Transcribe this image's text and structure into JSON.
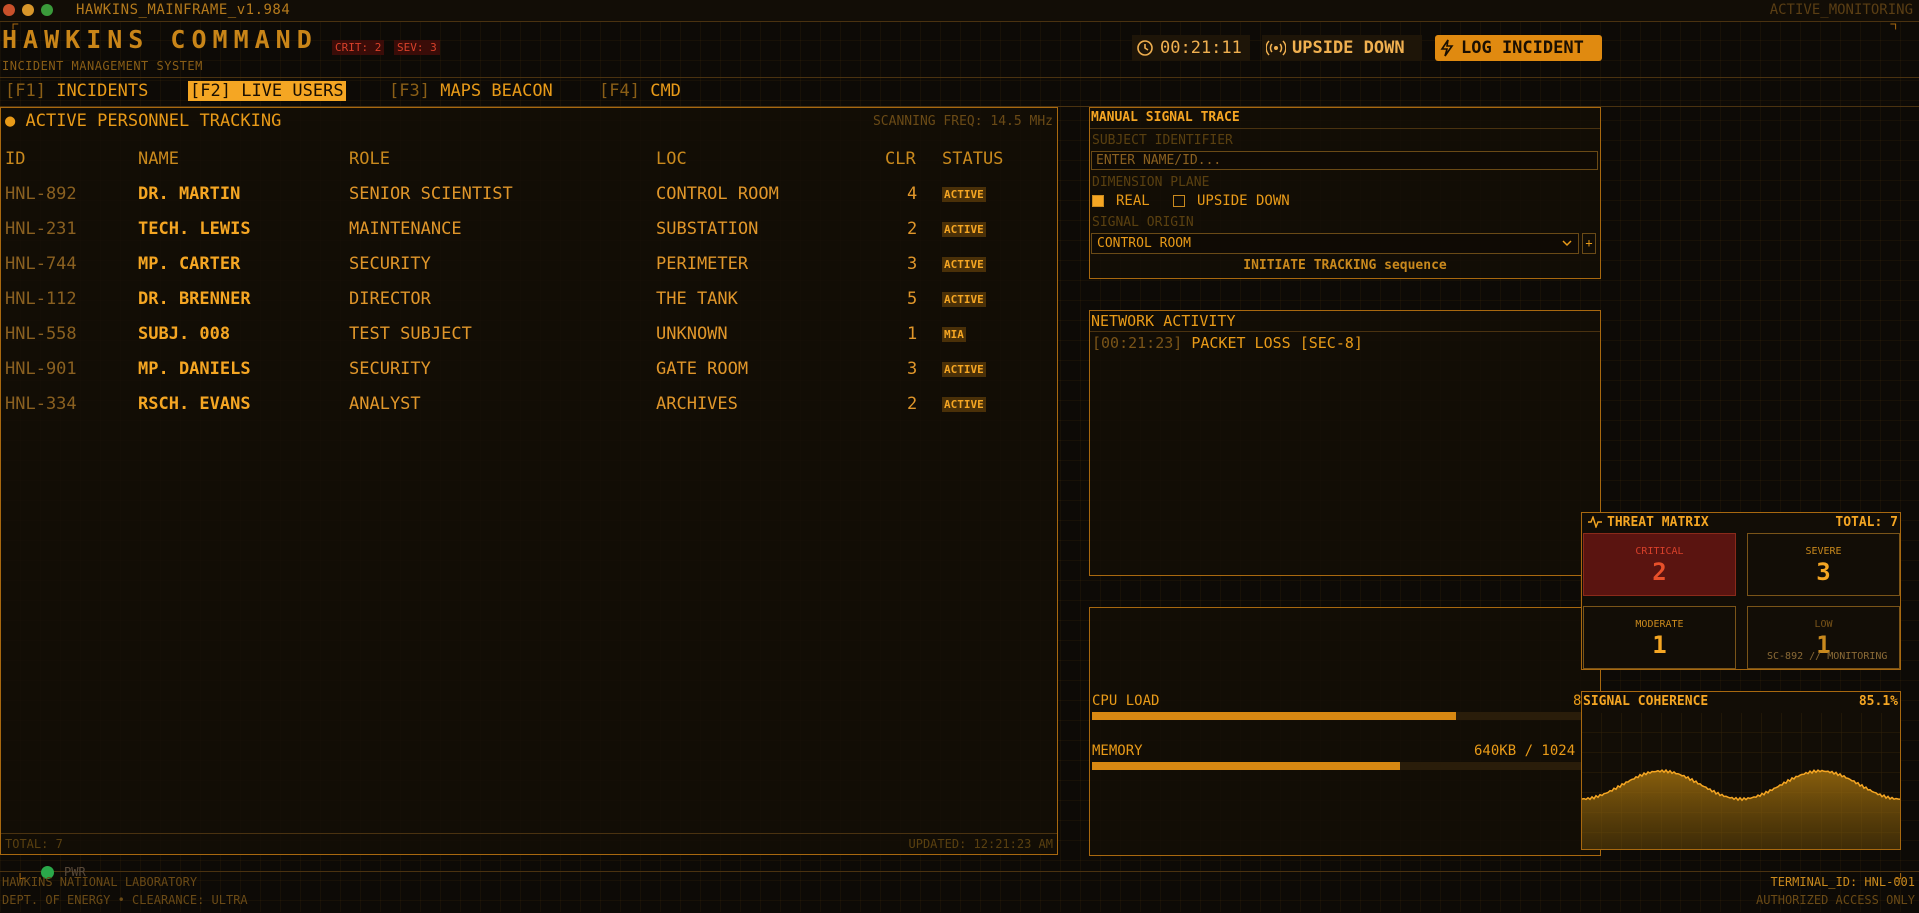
{
  "window": {
    "title": "HAWKINS_MAINFRAME_v1.984",
    "mode": "ACTIVE_MONITORING"
  },
  "header": {
    "brand": "HAWKINS COMMAND",
    "subtitle": "INCIDENT MANAGEMENT SYSTEM",
    "crit_badge": "CRIT: 2",
    "sev_badge": "SEV: 3",
    "clock": "00:21:11",
    "dimension": "UPSIDE DOWN",
    "log_button": "LOG INCIDENT"
  },
  "tabs": [
    {
      "key": "[F1]",
      "label": "INCIDENTS"
    },
    {
      "key": "[F2]",
      "label": "LIVE USERS"
    },
    {
      "key": "[F3]",
      "label": "MAPS BEACON"
    },
    {
      "key": "[F4]",
      "label": "CMD"
    }
  ],
  "personnel": {
    "title": "ACTIVE PERSONNEL TRACKING",
    "scan_freq": "SCANNING FREQ: 14.5 MHz",
    "columns": [
      "ID",
      "NAME",
      "ROLE",
      "LOC",
      "CLR",
      "STATUS"
    ],
    "rows": [
      {
        "id": "HNL-892",
        "name": "DR. MARTIN",
        "role": "SENIOR SCIENTIST",
        "loc": "CONTROL ROOM",
        "clr": "4",
        "status": "ACTIVE"
      },
      {
        "id": "HNL-231",
        "name": "TECH. LEWIS",
        "role": "MAINTENANCE",
        "loc": "SUBSTATION",
        "clr": "2",
        "status": "ACTIVE"
      },
      {
        "id": "HNL-744",
        "name": "MP. CARTER",
        "role": "SECURITY",
        "loc": "PERIMETER",
        "clr": "3",
        "status": "ACTIVE"
      },
      {
        "id": "HNL-112",
        "name": "DR. BRENNER",
        "role": "DIRECTOR",
        "loc": "THE TANK",
        "clr": "5",
        "status": "ACTIVE"
      },
      {
        "id": "HNL-558",
        "name": "SUBJ. 008",
        "role": "TEST SUBJECT",
        "loc": "UNKNOWN",
        "clr": "1",
        "status": "MIA"
      },
      {
        "id": "HNL-901",
        "name": "MP. DANIELS",
        "role": "SECURITY",
        "loc": "GATE ROOM",
        "clr": "3",
        "status": "ACTIVE"
      },
      {
        "id": "HNL-334",
        "name": "RSCH. EVANS",
        "role": "ANALYST",
        "loc": "ARCHIVES",
        "clr": "2",
        "status": "ACTIVE"
      }
    ],
    "total": "TOTAL: 7",
    "updated": "UPDATED: 12:21:23 AM"
  },
  "trace": {
    "title": "MANUAL SIGNAL TRACE",
    "subject_label": "SUBJECT IDENTIFIER",
    "subject_placeholder": "ENTER NAME/ID...",
    "plane_label": "DIMENSION PLANE",
    "opt_real": "REAL",
    "opt_upside": "UPSIDE DOWN",
    "origin_label": "SIGNAL ORIGIN",
    "origin_value": "CONTROL ROOM",
    "plus": "+",
    "init_button": "INITIATE TRACKING sequence"
  },
  "network": {
    "title": "NETWORK ACTIVITY",
    "entries": [
      {
        "time": "[00:21:23]",
        "msg": "PACKET LOSS [SEC-8]"
      }
    ]
  },
  "system": {
    "cpu_label": "CPU LOAD",
    "cpu_value_text": "8",
    "cpu_fraction": 0.74,
    "mem_label": "MEMORY",
    "mem_value_text": "640KB / 1024",
    "mem_fraction": 0.625
  },
  "threat": {
    "title": "THREAT MATRIX",
    "total": "TOTAL: 7",
    "cells": [
      {
        "label": "CRITICAL",
        "value": "2"
      },
      {
        "label": "SEVERE",
        "value": "3"
      },
      {
        "label": "MODERATE",
        "value": "1"
      },
      {
        "label": "LOW",
        "value": "1"
      }
    ],
    "status": "SC-892 // MONITORING"
  },
  "coherence": {
    "title": "SIGNAL COHERENCE",
    "value": "85.1%"
  },
  "footer": {
    "power": "PWR",
    "lab": "HAWKINS NATIONAL LABORATORY",
    "dept": "DEPT. OF ENERGY • CLEARANCE: ULTRA",
    "terminal": "TERMINAL_ID: HNL-001",
    "access": "AUTHORIZED ACCESS ONLY"
  },
  "colors": {
    "accent": "#f5a623",
    "critical": "#d8402a",
    "background": "#0d0a06"
  }
}
